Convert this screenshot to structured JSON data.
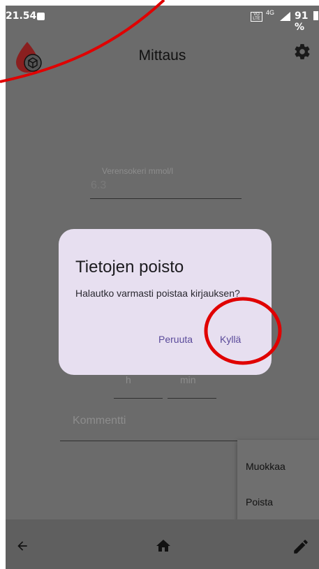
{
  "status_bar": {
    "time": "21.54",
    "volte": "VO LTE",
    "network": "4G",
    "battery": "91 %"
  },
  "app_bar": {
    "title": "Mittaus",
    "logo_icon": "blood-drop-logo-icon",
    "settings_icon": "gear-icon"
  },
  "form": {
    "glucose_label": "Verensokeri mmol/l",
    "glucose_value": "6.3",
    "hour_label": "h",
    "minute_label": "min",
    "comment_label": "Kommentti"
  },
  "popup_menu": {
    "items": [
      "Muokkaa",
      "Poista"
    ]
  },
  "dialog": {
    "title": "Tietojen poisto",
    "message": "Halautko varmasti poistaa kirjauksen?",
    "cancel_label": "Peruuta",
    "confirm_label": "Kyllä"
  },
  "bottom_nav": {
    "back_icon": "back-arrow-icon",
    "home_icon": "home-icon",
    "edit_icon": "pencil-icon"
  },
  "colors": {
    "scrim": "#6b6b6b",
    "dialog_bg": "#e7dff0",
    "accent": "#5a4a9a",
    "annotation": "#e00000"
  }
}
